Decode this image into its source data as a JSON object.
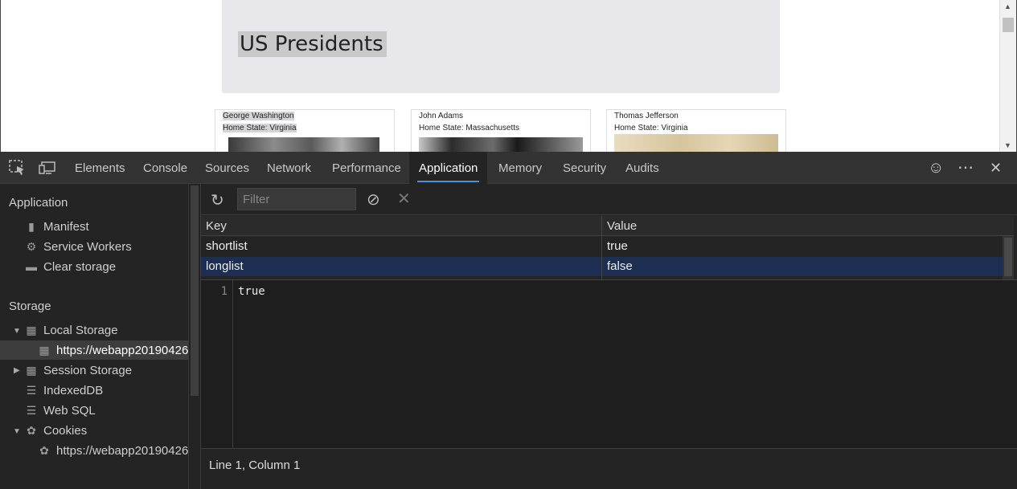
{
  "page": {
    "title": "US Presidents",
    "cards": [
      {
        "name": "George Washington",
        "state": "Home State: Virginia"
      },
      {
        "name": "John Adams",
        "state": "Home State: Massachusetts"
      },
      {
        "name": "Thomas Jefferson",
        "state": "Home State: Virginia"
      }
    ]
  },
  "devtools": {
    "tabs": [
      "Elements",
      "Console",
      "Sources",
      "Network",
      "Performance",
      "Application",
      "Memory",
      "Security",
      "Audits"
    ],
    "active_tab": "Application",
    "accent": "#4a90d9",
    "sidebar": {
      "app_heading": "Application",
      "app_items": [
        "Manifest",
        "Service Workers",
        "Clear storage"
      ],
      "storage_heading": "Storage",
      "local_storage": "Local Storage",
      "local_storage_origin": "https://webapp20190426",
      "session_storage": "Session Storage",
      "indexeddb": "IndexedDB",
      "websql": "Web SQL",
      "cookies": "Cookies",
      "cookies_origin": "https://webapp20190426"
    },
    "filter": {
      "placeholder": "Filter"
    },
    "table": {
      "headers": {
        "key": "Key",
        "value": "Value"
      },
      "rows": [
        {
          "key": "shortlist",
          "value": "true"
        },
        {
          "key": "longlist",
          "value": "false"
        }
      ],
      "selected_bg": "#1c2f52"
    },
    "preview": {
      "line_number": "1",
      "content": "true"
    },
    "status": "Line 1, Column 1"
  }
}
